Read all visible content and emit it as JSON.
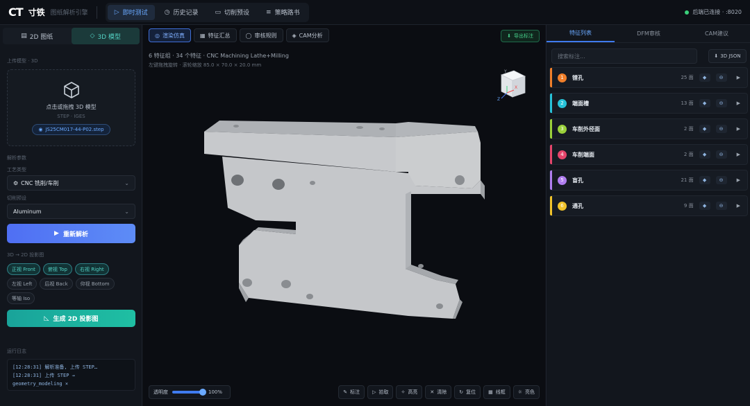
{
  "app": {
    "logo": "CT",
    "name": "寸铁",
    "subtitle": "图纸解析引擎",
    "nav": [
      {
        "label": "即时测试",
        "icon": "play-icon"
      },
      {
        "label": "历史记录",
        "icon": "clock-icon"
      },
      {
        "label": "切削预设",
        "icon": "layers-icon"
      },
      {
        "label": "策略路书",
        "icon": "book-icon"
      }
    ],
    "status": "后端已连接 · :8020",
    "status_color": "#3ad07a"
  },
  "left": {
    "mode_2d": "2D 图纸",
    "mode_3d": "3D 模型",
    "upload_label": "上传模型 · 3D",
    "upload_title": "点击或拖拽 3D 模型",
    "upload_formats": "STEP · IGES",
    "file_name": "JS25CM017-44-P02.step",
    "params_label": "解析参数",
    "process_label": "工艺类型",
    "process_value": "CNC 铣削/车削",
    "preset_label": "切削预设",
    "preset_value": "Aluminum",
    "reparse_label": "重新解析",
    "proj_label": "3D → 2D 投影图",
    "views": [
      {
        "label": "正视 Front",
        "on": true
      },
      {
        "label": "俯视 Top",
        "on": true
      },
      {
        "label": "右视 Right",
        "on": true
      },
      {
        "label": "左视 Left",
        "on": false
      },
      {
        "label": "后视 Back",
        "on": false
      },
      {
        "label": "仰视 Bottom",
        "on": false
      },
      {
        "label": "等轴 Iso",
        "on": false
      }
    ],
    "gen_label": "生成 2D 投影图",
    "log_label": "运行日志",
    "log_lines": [
      "[12:28:31] 解析准备, 上传 STEP…",
      "[12:28:31] 上传 STEP →",
      "geometry_modeling ×"
    ]
  },
  "center": {
    "tabs": [
      {
        "label": "渲染仿真",
        "icon": "eye-icon",
        "active": true
      },
      {
        "label": "特征汇总",
        "icon": "table-icon",
        "active": false
      },
      {
        "label": "审核规则",
        "icon": "shield-icon",
        "active": false
      },
      {
        "label": "CAM分析",
        "icon": "stack-icon",
        "active": false
      }
    ],
    "export_label": "导出标注",
    "info_line1": "6 特征组 · 34 个特征 · CNC Machining Lathe+Milling",
    "info_line2": "左键拖拽旋转 · 滚轮缩放   85.0 × 70.0 × 20.0 mm",
    "viewcube_axes": [
      "Y",
      "X",
      "Z"
    ],
    "opacity_label": "透明度",
    "opacity_value": "100%",
    "opacity_fraction": 1.0,
    "tools": [
      {
        "label": "标注",
        "icon": "edit-icon"
      },
      {
        "label": "拾取",
        "icon": "pointer-icon"
      },
      {
        "label": "高亮",
        "icon": "highlight-icon"
      },
      {
        "label": "清除",
        "icon": "close-icon"
      },
      {
        "label": "复位",
        "icon": "reset-icon"
      },
      {
        "label": "线框",
        "icon": "grid-icon"
      },
      {
        "label": "亮色",
        "icon": "sun-icon"
      }
    ]
  },
  "right": {
    "tabs": [
      "特征列表",
      "DFM审核",
      "CAM建议"
    ],
    "search_placeholder": "搜索标注...",
    "json_label": "3D JSON",
    "features": [
      {
        "n": "1",
        "name": "镗孔",
        "count": "25 面",
        "color": "#f07f2a"
      },
      {
        "n": "2",
        "name": "端面槽",
        "count": "13 面",
        "color": "#27c2d8"
      },
      {
        "n": "3",
        "name": "车削外径面",
        "count": "2 面",
        "color": "#9ad03a"
      },
      {
        "n": "4",
        "name": "车削端面",
        "count": "2 面",
        "color": "#e5456b"
      },
      {
        "n": "5",
        "name": "盲孔",
        "count": "21 面",
        "color": "#b07ef0"
      },
      {
        "n": "6",
        "name": "通孔",
        "count": "9 面",
        "color": "#f0c22a"
      }
    ]
  }
}
